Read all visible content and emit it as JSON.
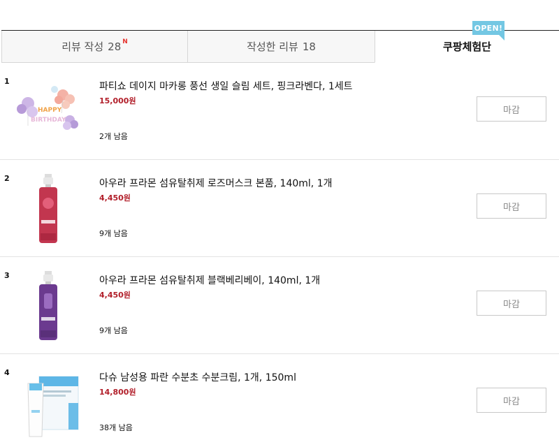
{
  "tabs": [
    {
      "label": "리뷰 작성",
      "count": "28",
      "new_mark": "N"
    },
    {
      "label": "작성한 리뷰",
      "count": "18"
    },
    {
      "label": "쿠팡체험단"
    }
  ],
  "open_badge": "OPEN!",
  "items": [
    {
      "rank": "1",
      "title": "파티쇼 데이지 마카롱 풍선 생일 슬림 세트, 핑크라벤다, 1세트",
      "price": "15,000원",
      "remaining": "2개 남음",
      "button": "마감",
      "thumb_icon": "balloon-set-image"
    },
    {
      "rank": "2",
      "title": "아우라 프라몬 섬유탈취제 로즈머스크 본품, 140ml, 1개",
      "price": "4,450원",
      "remaining": "9개 남음",
      "button": "마감",
      "thumb_icon": "spray-bottle-pink-image"
    },
    {
      "rank": "3",
      "title": "아우라 프라몬 섬유탈취제 블랙베리베이, 140ml, 1개",
      "price": "4,450원",
      "remaining": "9개 남음",
      "button": "마감",
      "thumb_icon": "spray-bottle-purple-image"
    },
    {
      "rank": "4",
      "title": "다슈 남성용 파란 수분초 수분크림, 1개, 150ml",
      "price": "14,800원",
      "remaining": "38개 남음",
      "button": "마감",
      "thumb_icon": "cream-tube-image"
    }
  ],
  "colors": {
    "accent_price": "#b2202b",
    "badge": "#73c7e3"
  }
}
